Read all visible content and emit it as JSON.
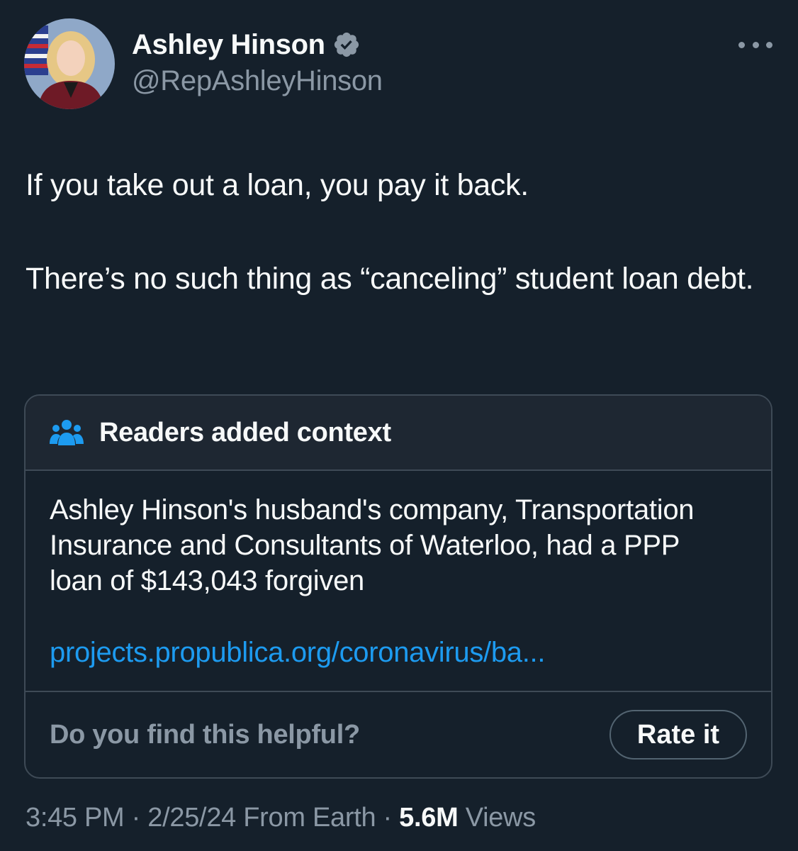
{
  "author": {
    "display_name": "Ashley Hinson",
    "handle": "@RepAshleyHinson",
    "verified": true,
    "avatar_icon": "avatar-photo",
    "badge_color": "#8b98a5"
  },
  "menu": {
    "icon": "more-horizontal-icon"
  },
  "tweet": {
    "lines": [
      "If you take out a loan, you pay it back.",
      "There’s no such thing as “canceling” student loan debt."
    ]
  },
  "community_note": {
    "icon": "people-icon",
    "header": "Readers added context",
    "text": "Ashley Hinson's husband's company, Transportation Insurance and Consultants of Waterloo, had a PPP loan of $143,043 forgiven",
    "link": "projects.propublica.org/coronavirus/ba...",
    "helpful_question": "Do you find this helpful?",
    "rate_label": "Rate it"
  },
  "meta": {
    "time": "3:45 PM",
    "separator": " · ",
    "date": "2/25/24",
    "source": "From Earth",
    "views_count": "5.6M",
    "views_label": "Views"
  },
  "colors": {
    "background": "#15202b",
    "text_primary": "#f7f9f9",
    "text_secondary": "#8b98a5",
    "link": "#1d9bf0",
    "note_icon": "#1d9bf0",
    "border": "#3e4a56"
  }
}
